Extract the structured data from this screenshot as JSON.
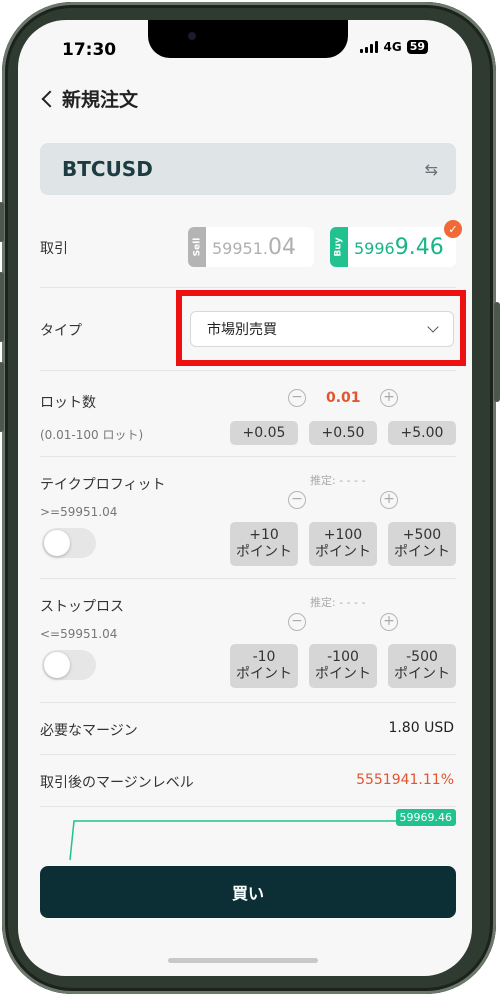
{
  "status": {
    "time": "17:30",
    "network": "4G",
    "battery": "59"
  },
  "nav": {
    "title": "新規注文"
  },
  "symbol": {
    "name": "BTCUSD",
    "swap_icon": "swap-arrows-icon"
  },
  "trade": {
    "label": "取引",
    "sell_tag": "Sell",
    "sell_price_main": "59951.",
    "sell_price_big": "04",
    "buy_tag": "Buy",
    "buy_price_main": "5996",
    "buy_price_big": "9.46",
    "selected_check": "✓"
  },
  "type": {
    "label": "タイプ",
    "selected": "市場別売買"
  },
  "lot": {
    "label": "ロット数",
    "range": "(0.01-100 ロット)",
    "value": "0.01",
    "minus": "−",
    "plus": "+",
    "chips": [
      "+0.05",
      "+0.50",
      "+5.00"
    ]
  },
  "take_profit": {
    "label": "テイクプロフィット",
    "condition": ">=59951.04",
    "estimate": "推定: - - - -",
    "minus": "−",
    "plus": "+",
    "chips": [
      "+10\nポイント",
      "+100\nポイント",
      "+500\nポイント"
    ],
    "enabled": false
  },
  "stop_loss": {
    "label": "ストップロス",
    "condition": "<=59951.04",
    "estimate": "推定: - - - -",
    "minus": "−",
    "plus": "+",
    "chips": [
      "-10\nポイント",
      "-100\nポイント",
      "-500\nポイント"
    ],
    "enabled": false
  },
  "margin": {
    "required_label": "必要なマージン",
    "required_value": "1.80 USD",
    "level_label": "取引後のマージンレベル",
    "level_value": "5551941.11%"
  },
  "chart": {
    "price_tag": "59969.46"
  },
  "action": {
    "buy_label": "買い"
  },
  "colors": {
    "accent_green": "#21c28f",
    "accent_red": "#e1552f",
    "button_dark": "#0b2f35",
    "highlight_frame": "#ee1111"
  }
}
